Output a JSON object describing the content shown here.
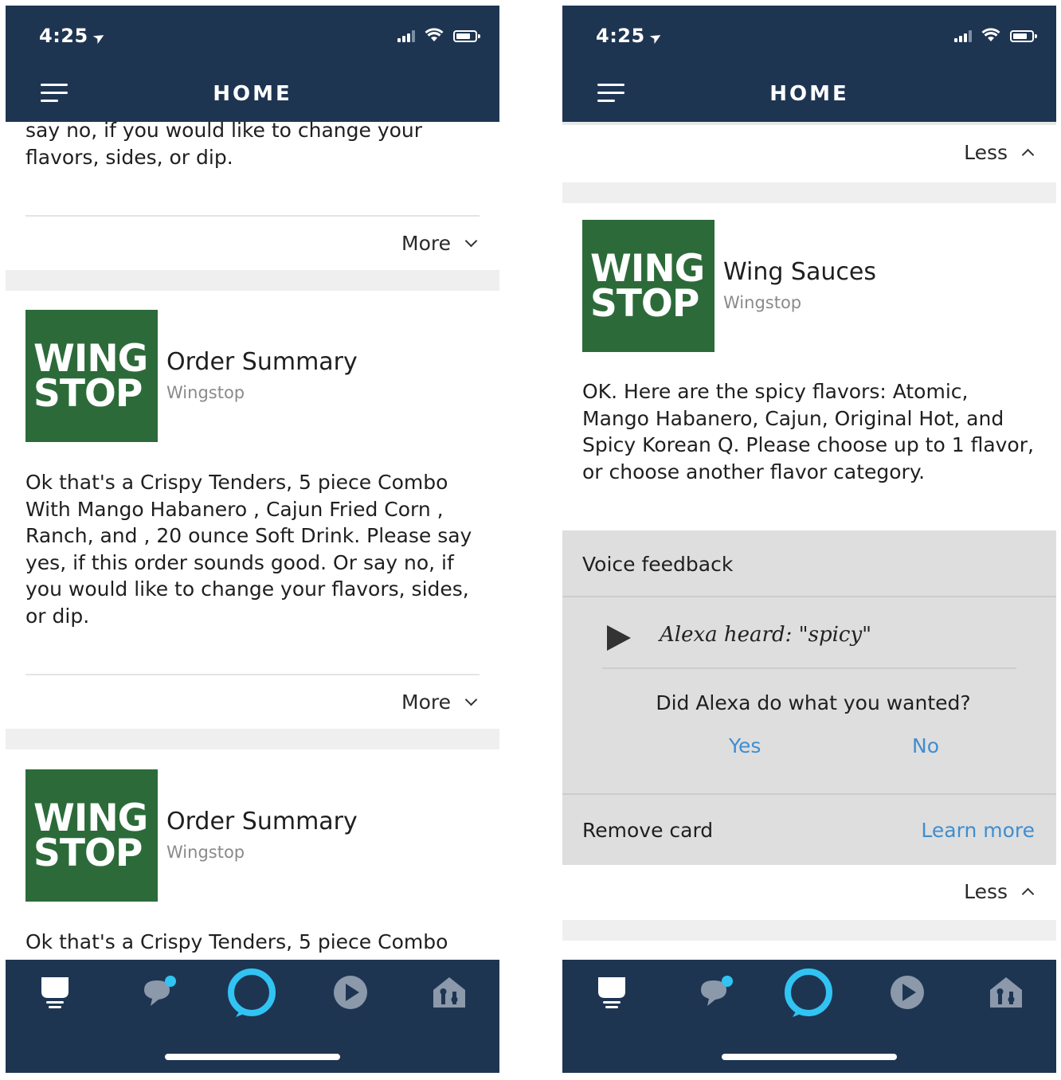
{
  "screens": [
    {
      "status_time": "4:25",
      "header_title": "HOME",
      "top_text": "say no, if you would like to change your flavors, sides, or dip.",
      "more_label": "More",
      "cards": [
        {
          "logo_line1": "WING",
          "logo_line2": "STOP",
          "title": "Order Summary",
          "subtitle": "Wingstop",
          "body": "Ok that's a Crispy Tenders, 5 piece Combo With Mango Habanero , Cajun Fried Corn , Ranch, and , 20 ounce Soft Drink. Please say yes, if this order sounds good. Or say no, if you would like to change your flavors, sides, or dip.",
          "toggle_label": "More"
        },
        {
          "logo_line1": "WING",
          "logo_line2": "STOP",
          "title": "Order Summary",
          "subtitle": "Wingstop",
          "body": "Ok that's a Crispy Tenders, 5 piece Combo"
        }
      ]
    },
    {
      "status_time": "4:25",
      "header_title": "HOME",
      "less_label_top": "Less",
      "card": {
        "logo_line1": "WING",
        "logo_line2": "STOP",
        "title": "Wing Sauces",
        "subtitle": "Wingstop",
        "body": "OK. Here are the spicy flavors: Atomic, Mango Habanero, Cajun, Original Hot,  and Spicy Korean Q. Please choose up to 1 flavor, or choose another flavor category."
      },
      "voice_feedback": {
        "label": "Voice feedback",
        "heard": "Alexa heard: \"spicy\"",
        "question": "Did Alexa do what you wanted?",
        "yes": "Yes",
        "no": "No"
      },
      "remove_card": "Remove card",
      "learn_more": "Learn more",
      "less_label_bottom": "Less"
    }
  ],
  "tabs": [
    "home-icon",
    "communicate-icon",
    "alexa-icon",
    "play-icon",
    "devices-icon"
  ],
  "colors": {
    "navy": "#1e3552",
    "wingstop_green": "#2c6b39",
    "alexa_blue": "#31c4f3",
    "link_blue": "#3f8ed0",
    "feedback_gray": "#dedede"
  }
}
